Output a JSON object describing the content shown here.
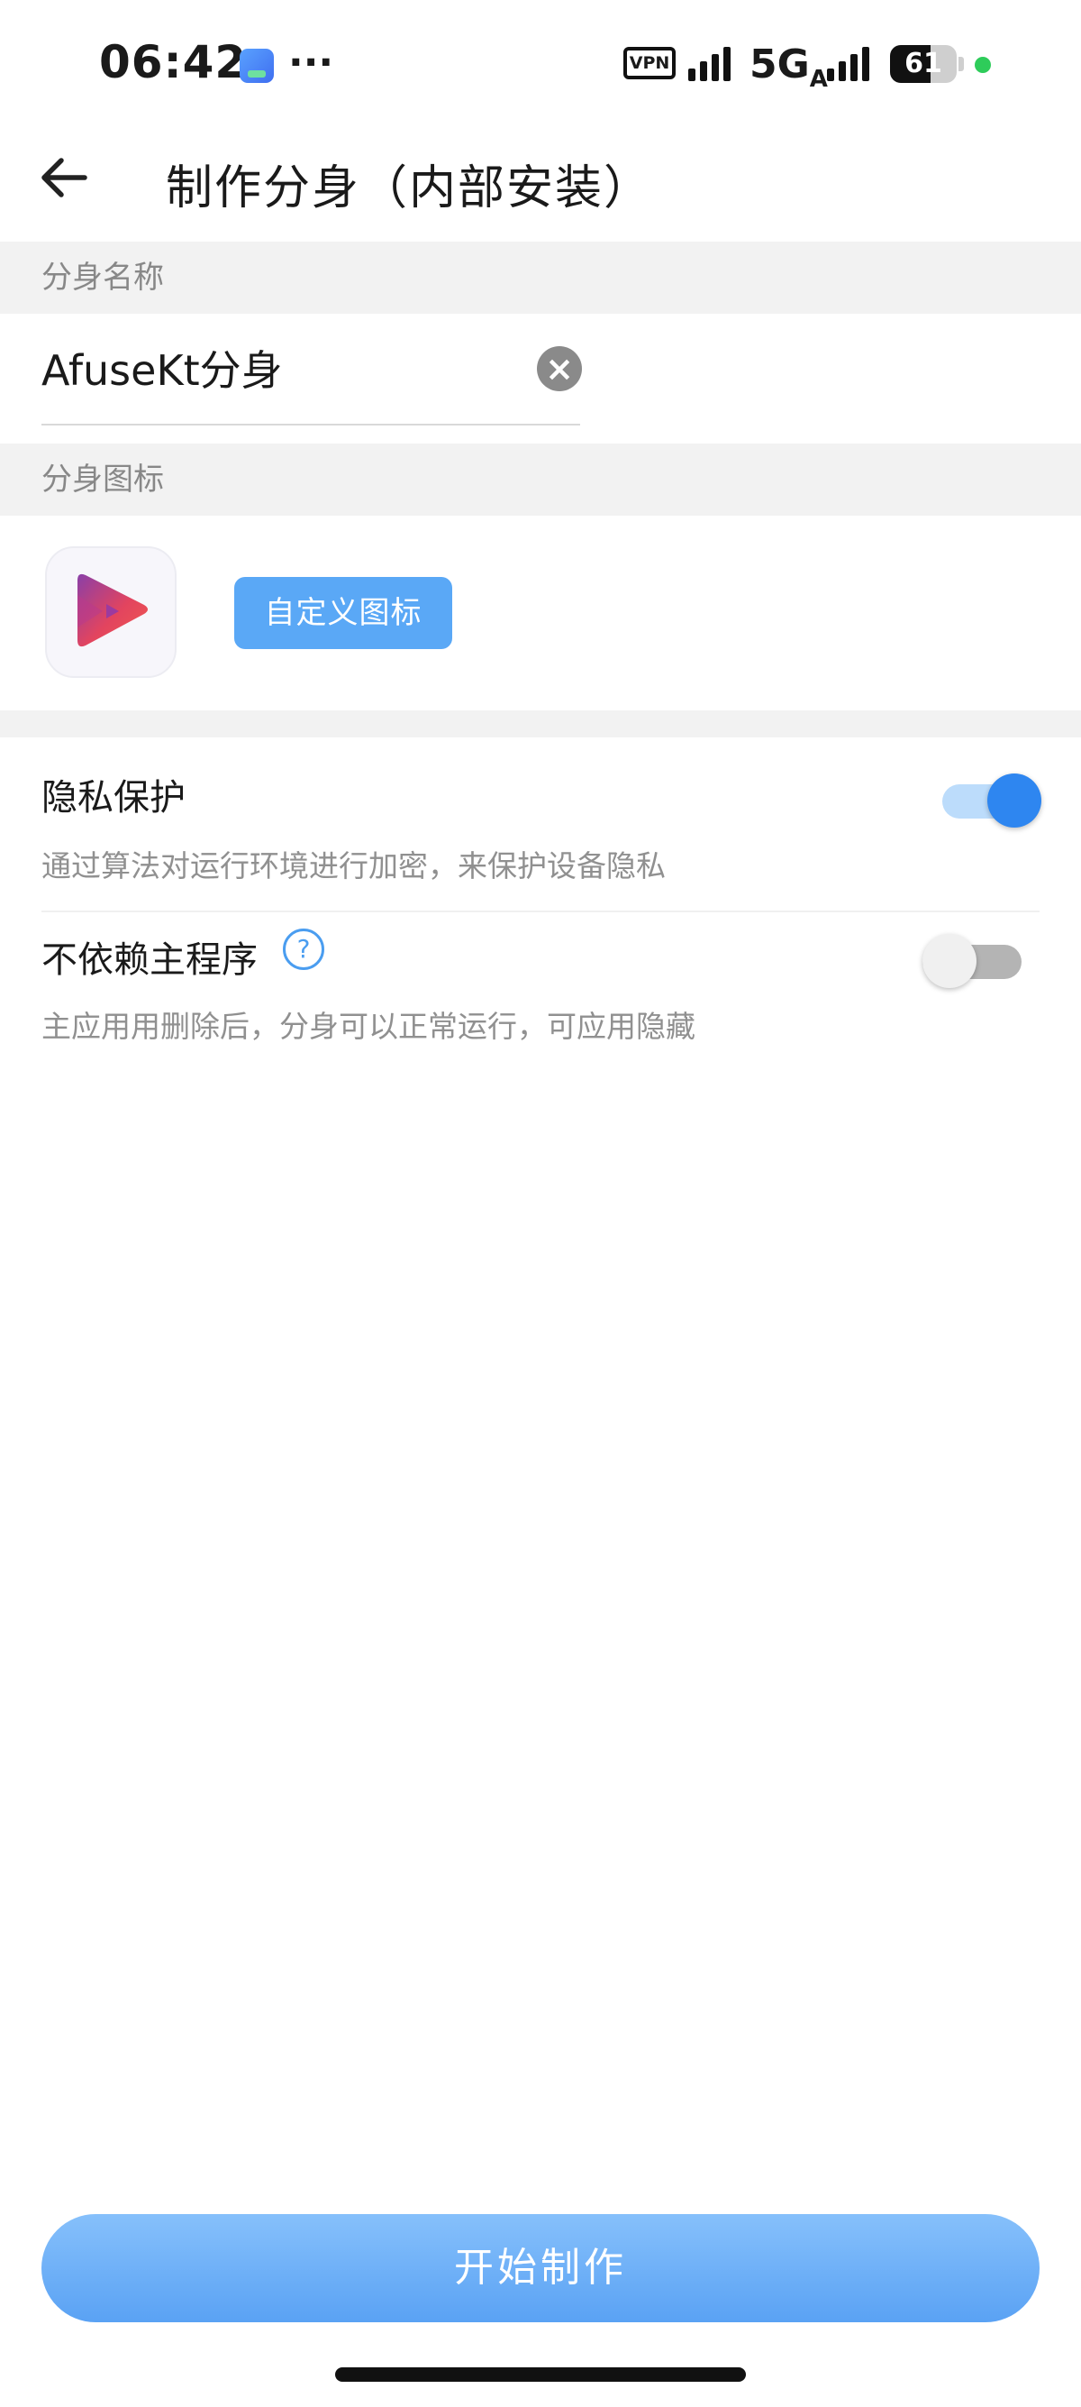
{
  "status_bar": {
    "time": "06:42",
    "more": "···",
    "vpn": "VPN",
    "network": "5G",
    "network_sub": "A",
    "battery_level": "61",
    "battery_fraction": 0.61
  },
  "header": {
    "title": "制作分身（内部安装）"
  },
  "name_section": {
    "label": "分身名称",
    "value": "AfuseKt分身"
  },
  "icon_section": {
    "label": "分身图标",
    "custom_button": "自定义图标"
  },
  "settings": {
    "privacy": {
      "title": "隐私保护",
      "description": "通过算法对运行环境进行加密，来保护设备隐私",
      "enabled": true
    },
    "independent": {
      "title": "不依赖主程序",
      "description": "主应用用删除后，分身可以正常运行，可应用隐藏",
      "help": "?",
      "enabled": false
    }
  },
  "actions": {
    "start": "开始制作"
  },
  "colors": {
    "accent": "#2e86f0",
    "button": "#5aa8f6",
    "section_bg": "#f2f2f2"
  }
}
